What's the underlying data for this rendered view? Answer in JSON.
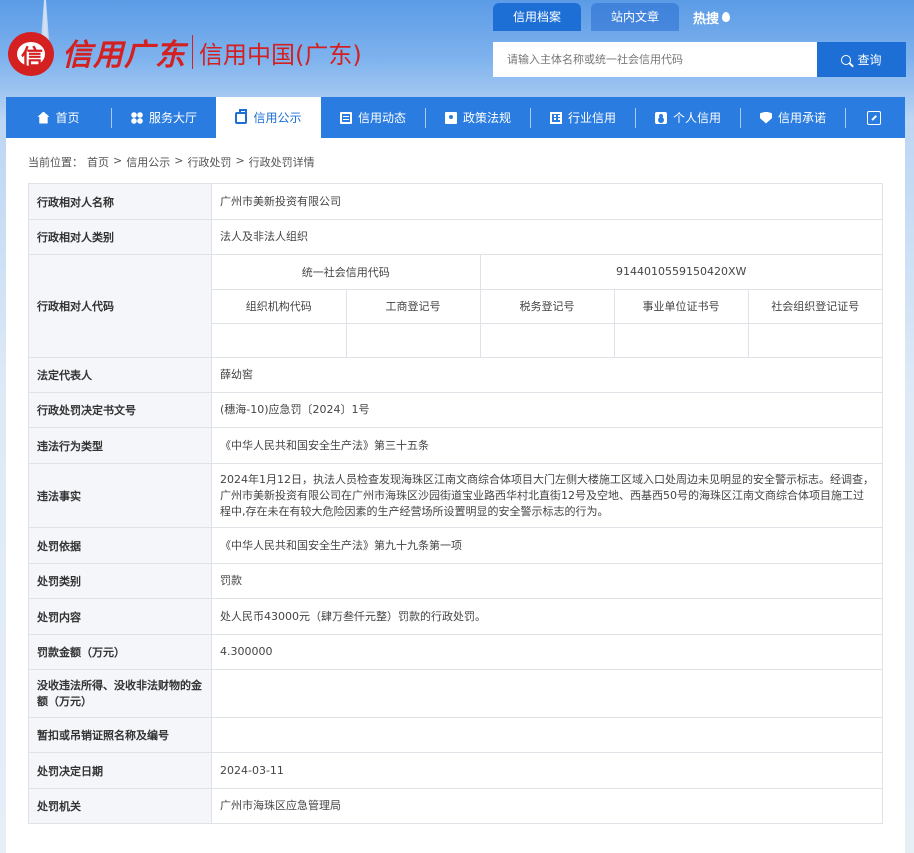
{
  "logo": {
    "mark_char": "信",
    "brand_cn": "信用广东",
    "site_name": "信用中国(广东)"
  },
  "top_tabs": [
    {
      "label": "信用档案",
      "active": true
    },
    {
      "label": "站内文章",
      "active": false
    }
  ],
  "hot_label": "热搜",
  "search": {
    "placeholder": "请输入主体名称或统一社会信用代码",
    "button_label": "查询"
  },
  "nav": [
    {
      "label": "首页",
      "icon": "home-icon",
      "active": false
    },
    {
      "label": "服务大厅",
      "icon": "grid-icon",
      "active": false
    },
    {
      "label": "信用公示",
      "icon": "briefcase-icon",
      "active": true
    },
    {
      "label": "信用动态",
      "icon": "document-icon",
      "active": false
    },
    {
      "label": "政策法规",
      "icon": "book-icon",
      "active": false
    },
    {
      "label": "行业信用",
      "icon": "building-icon",
      "active": false
    },
    {
      "label": "个人信用",
      "icon": "person-card-icon",
      "active": false
    },
    {
      "label": "信用承诺",
      "icon": "shield-icon",
      "active": false
    }
  ],
  "breadcrumb": {
    "prefix": "当前位置：",
    "items": [
      "首页",
      "信用公示",
      "行政处罚",
      "行政处罚详情"
    ],
    "sep": ">"
  },
  "detail": {
    "name_label": "行政相对人名称",
    "name_value": "广州市美新投资有限公司",
    "category_label": "行政相对人类别",
    "category_value": "法人及非法人组织",
    "code_label": "行政相对人代码",
    "uscc_label": "统一社会信用代码",
    "uscc_value": "9144010559150420XW",
    "code_headers": [
      "组织机构代码",
      "工商登记号",
      "税务登记号",
      "事业单位证书号",
      "社会组织登记证号"
    ],
    "legal_rep_label": "法定代表人",
    "legal_rep_value": "薛幼窖",
    "doc_no_label": "行政处罚决定书文号",
    "doc_no_value": "(穗海-10)应急罚〔2024〕1号",
    "violation_type_label": "违法行为类型",
    "violation_type_value": "《中华人民共和国安全生产法》第三十五条",
    "facts_label": "违法事实",
    "facts_value": "2024年1月12日，执法人员检查发现海珠区江南文商综合体项目大门左侧大楼施工区域入口处周边未见明显的安全警示标志。经调查，广州市美新投资有限公司在广州市海珠区沙园街道宝业路西华村北直街12号及空地、西基西50号的海珠区江南文商综合体项目施工过程中,存在未在有较大危险因素的生产经营场所设置明显的安全警示标志的行为。",
    "basis_label": "处罚依据",
    "basis_value": "《中华人民共和国安全生产法》第九十九条第一项",
    "penalty_type_label": "处罚类别",
    "penalty_type_value": "罚款",
    "penalty_content_label": "处罚内容",
    "penalty_content_value": "处人民币43000元（肆万叁仟元整）罚款的行政处罚。",
    "fine_label": "罚款金额（万元）",
    "fine_value": "4.300000",
    "confiscate_label": "没收违法所得、没收非法财物的金额（万元）",
    "confiscate_value": "",
    "license_label": "暂扣或吊销证照名称及编号",
    "license_value": "",
    "date_label": "处罚决定日期",
    "date_value": "2024-03-11",
    "authority_label": "处罚机关",
    "authority_value": "广州市海珠区应急管理局"
  }
}
